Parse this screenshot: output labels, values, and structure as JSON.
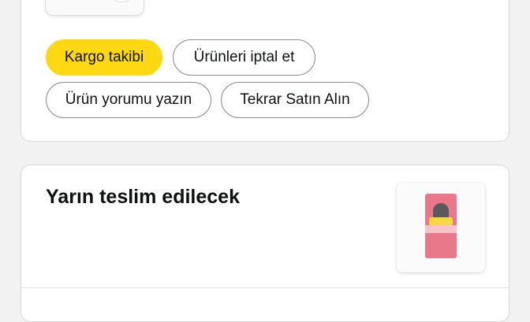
{
  "order_actions": {
    "track_package": "Kargo takibi",
    "cancel_items": "Ürünleri iptal et",
    "write_review": "Ürün yorumu yazın",
    "buy_again": "Tekrar Satın Alın"
  },
  "next_order": {
    "delivery_status": "Yarın teslim edilecek"
  },
  "colors": {
    "primary_button": "#ffd814",
    "background": "#f2f2f2",
    "card": "#ffffff"
  }
}
